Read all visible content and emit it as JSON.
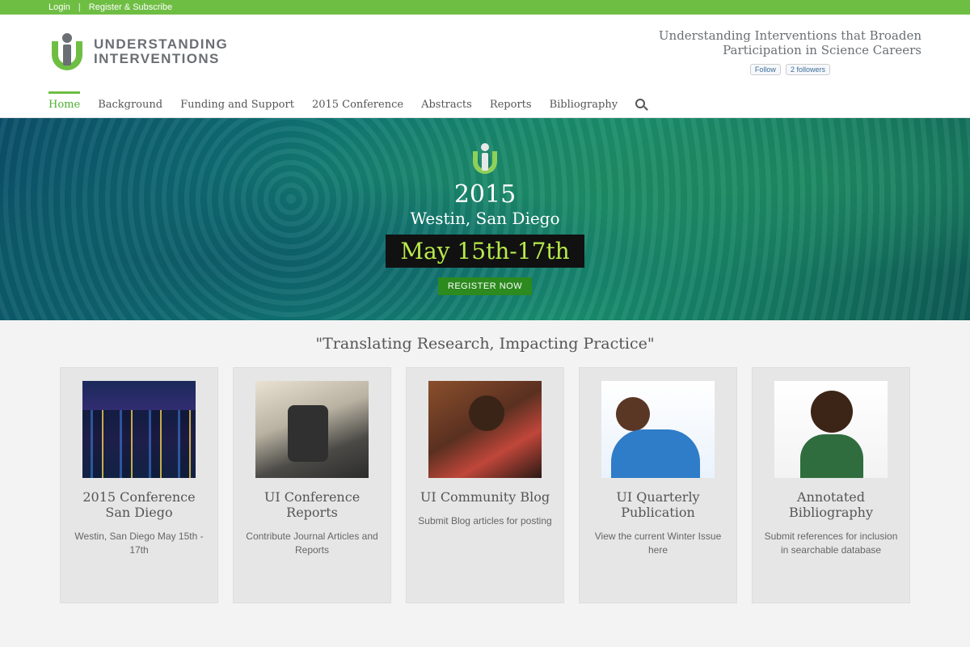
{
  "topbar": {
    "login": "Login",
    "register": "Register & Subscribe"
  },
  "logo": {
    "line1": "UNDERSTANDING",
    "line2": "INTERVENTIONS"
  },
  "tagline": {
    "line1": "Understanding Interventions that Broaden",
    "line2": "Participation in Science Careers"
  },
  "social": {
    "follow": "Follow",
    "count": "2 followers"
  },
  "nav": {
    "items": [
      "Home",
      "Background",
      "Funding and Support",
      "2015 Conference",
      "Abstracts",
      "Reports",
      "Bibliography"
    ],
    "active_index": 0
  },
  "hero": {
    "year": "2015",
    "venue": "Westin, San Diego",
    "dates": "May 15th-17th",
    "register": "REGISTER NOW"
  },
  "quote": "\"Translating Research, Impacting Practice\"",
  "cards": [
    {
      "title": "2015 Conference San Diego",
      "desc": "Westin, San Diego May 15th - 17th"
    },
    {
      "title": "UI Conference Reports",
      "desc": "Contribute Journal Articles and Reports"
    },
    {
      "title": "UI Community Blog",
      "desc": "Submit Blog articles for posting"
    },
    {
      "title": "UI Quarterly Publication",
      "desc": "View the current Winter Issue here"
    },
    {
      "title": "Annotated Bibliography",
      "desc": "Submit references for inclusion in searchable database"
    }
  ],
  "colors": {
    "brand_green": "#6fbe44",
    "dates_text": "#b8ea4c",
    "register_button": "#2c8a1e"
  }
}
